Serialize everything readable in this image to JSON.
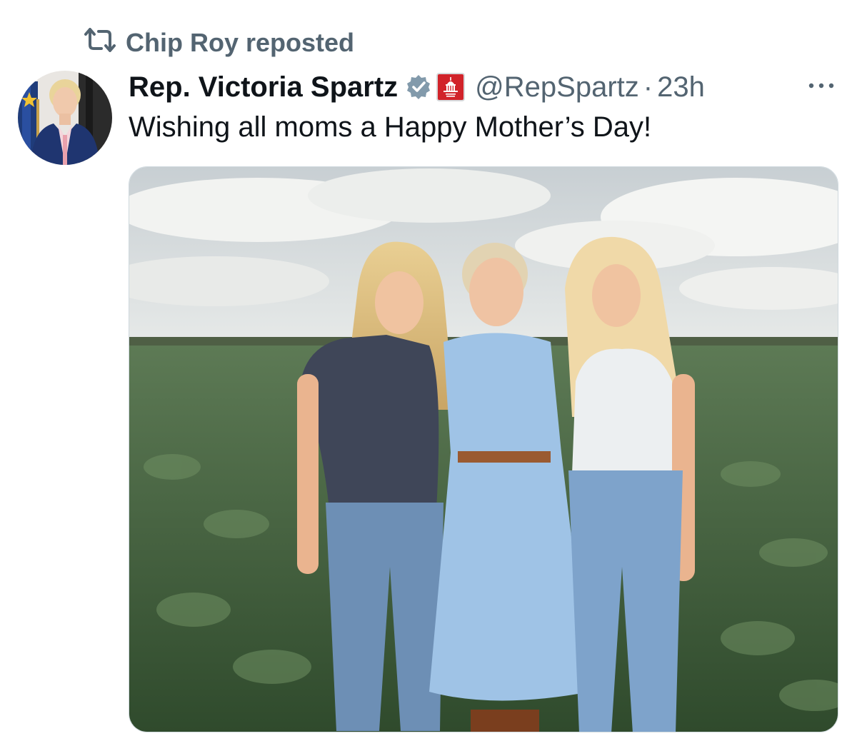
{
  "social_context": {
    "label": "Chip Roy reposted",
    "icon": "repost-icon"
  },
  "author": {
    "display_name": "Rep. Victoria Spartz",
    "handle": "@RepSpartz",
    "separator": "·",
    "time": "23h",
    "verified_badge": "verified-badge-icon",
    "affiliation_badge": "house-gop-badge-icon"
  },
  "tweet": {
    "text": "Wishing all moms a Happy Mother’s Day!"
  },
  "actions": {
    "more_icon": "more-options-icon"
  },
  "colors": {
    "secondary_text": "#536471",
    "primary_text": "#0f1419",
    "verified_blue": "#829aab",
    "gop_red": "#d1232a"
  }
}
